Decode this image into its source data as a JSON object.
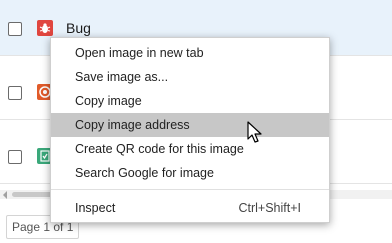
{
  "rows": [
    {
      "label": "Bug",
      "icon": "bug-icon",
      "color": "#e0463f"
    },
    {
      "label": "",
      "icon": "target-icon",
      "color": "#e15b2a"
    },
    {
      "label": "",
      "icon": "checklist-icon",
      "color": "#3aa87a"
    }
  ],
  "pagination": {
    "label": "Page 1 of 1"
  },
  "context_menu": {
    "items": [
      {
        "label": "Open image in new tab"
      },
      {
        "label": "Save image as..."
      },
      {
        "label": "Copy image"
      },
      {
        "label": "Copy image address"
      },
      {
        "label": "Create QR code for this image"
      },
      {
        "label": "Search Google for image"
      }
    ],
    "inspect": {
      "label": "Inspect",
      "shortcut": "Ctrl+Shift+I"
    }
  },
  "colors": {
    "selected_row": "#e8f2fb",
    "menu_hover": "#c7c7c7"
  }
}
